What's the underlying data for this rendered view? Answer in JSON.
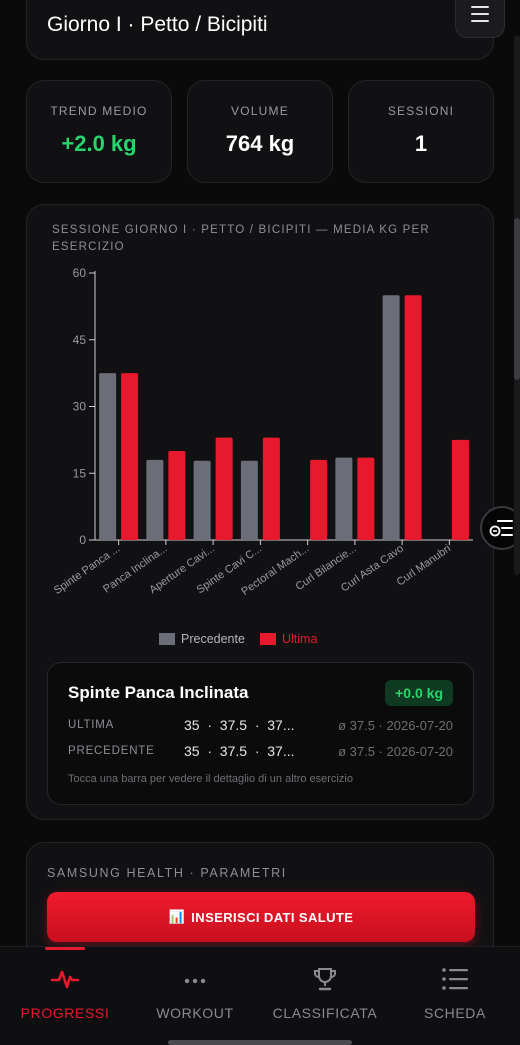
{
  "header": {
    "title": "Giorno I · Petto / Bicipiti"
  },
  "stats": [
    {
      "label": "TREND MEDIO",
      "value": "+2.0 kg",
      "color": "#28d46c"
    },
    {
      "label": "VOLUME",
      "value": "764 kg",
      "color": "#ffffff"
    },
    {
      "label": "SESSIONI",
      "value": "1",
      "color": "#ffffff"
    }
  ],
  "chart_title": "SESSIONE GIORNO I · PETTO / BICIPITI — MEDIA KG PER ESERCIZIO",
  "chart_data": {
    "type": "bar",
    "categories": [
      "Spinte Panca ...",
      "Panca Inclina...",
      "Aperture Cavi...",
      "Spinte Cavi C...",
      "Pectoral Mach...",
      "Curl Bilancie...",
      "Curl Asta Cavo",
      "Curl Manubri"
    ],
    "series": [
      {
        "name": "Precedente",
        "color": "#6b6e78",
        "values": [
          37.5,
          18,
          17.8,
          17.8,
          null,
          18.5,
          55,
          null
        ]
      },
      {
        "name": "Ultima",
        "color": "#e8192c",
        "values": [
          37.5,
          20,
          23,
          23,
          18,
          18.5,
          55,
          22.5
        ]
      }
    ],
    "y_ticks": [
      0,
      15,
      30,
      45,
      60
    ],
    "ylim": [
      0,
      60
    ],
    "legend_position": "bottom"
  },
  "detail": {
    "name": "Spinte Panca Inclinata",
    "badge": "+0.0 kg",
    "rows": [
      {
        "label": "ULTIMA",
        "values": "35  ·  37.5  ·  37...",
        "avg": "ø 37.5 · 2026-07-20"
      },
      {
        "label": "PRECEDENTE",
        "values": "35  ·  37.5  ·  37...",
        "avg": "ø 37.5 · 2026-07-20"
      }
    ],
    "hint": "Tocca una barra per vedere il dettaglio di un altro esercizio"
  },
  "health": {
    "title": "SAMSUNG HEALTH · PARAMETRI",
    "button_icon": "📊",
    "button_label": "INSERISCI DATI SALUTE"
  },
  "nav": [
    {
      "label": "PROGRESSI",
      "icon": "pulse-icon",
      "active": true
    },
    {
      "label": "WORKOUT",
      "icon": "dots-icon",
      "active": false
    },
    {
      "label": "CLASSIFICATA",
      "icon": "trophy-icon",
      "active": false
    },
    {
      "label": "SCHEDA",
      "icon": "list-icon",
      "active": false
    }
  ]
}
